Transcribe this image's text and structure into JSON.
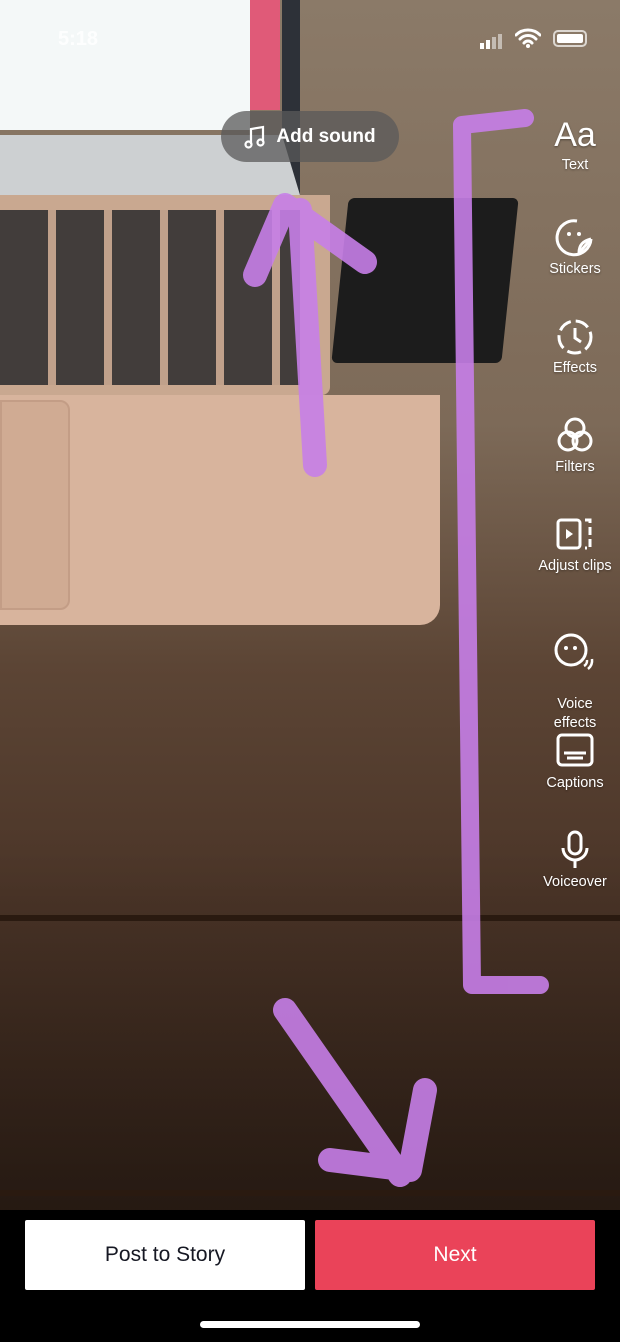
{
  "status_bar": {
    "time": "5:18"
  },
  "add_sound": {
    "label": "Add sound",
    "icon": "music-note-icon"
  },
  "tools": [
    {
      "label": "Text",
      "icon": "text-aa-icon",
      "glyph": "Aa"
    },
    {
      "label": "Stickers",
      "icon": "sticker-icon"
    },
    {
      "label": "Effects",
      "icon": "effects-timer-icon"
    },
    {
      "label": "Filters",
      "icon": "filters-circles-icon"
    },
    {
      "label": "Adjust clips",
      "icon": "adjust-clips-icon"
    },
    {
      "label": "Voice\neffects",
      "icon": "voice-effects-icon"
    },
    {
      "label": "Captions",
      "icon": "captions-icon"
    },
    {
      "label": "Voiceover",
      "icon": "microphone-icon"
    }
  ],
  "bottom": {
    "post_to_story": "Post to Story",
    "next": "Next"
  },
  "colors": {
    "next": "#ea4359",
    "annotation": "#c77ee8"
  }
}
